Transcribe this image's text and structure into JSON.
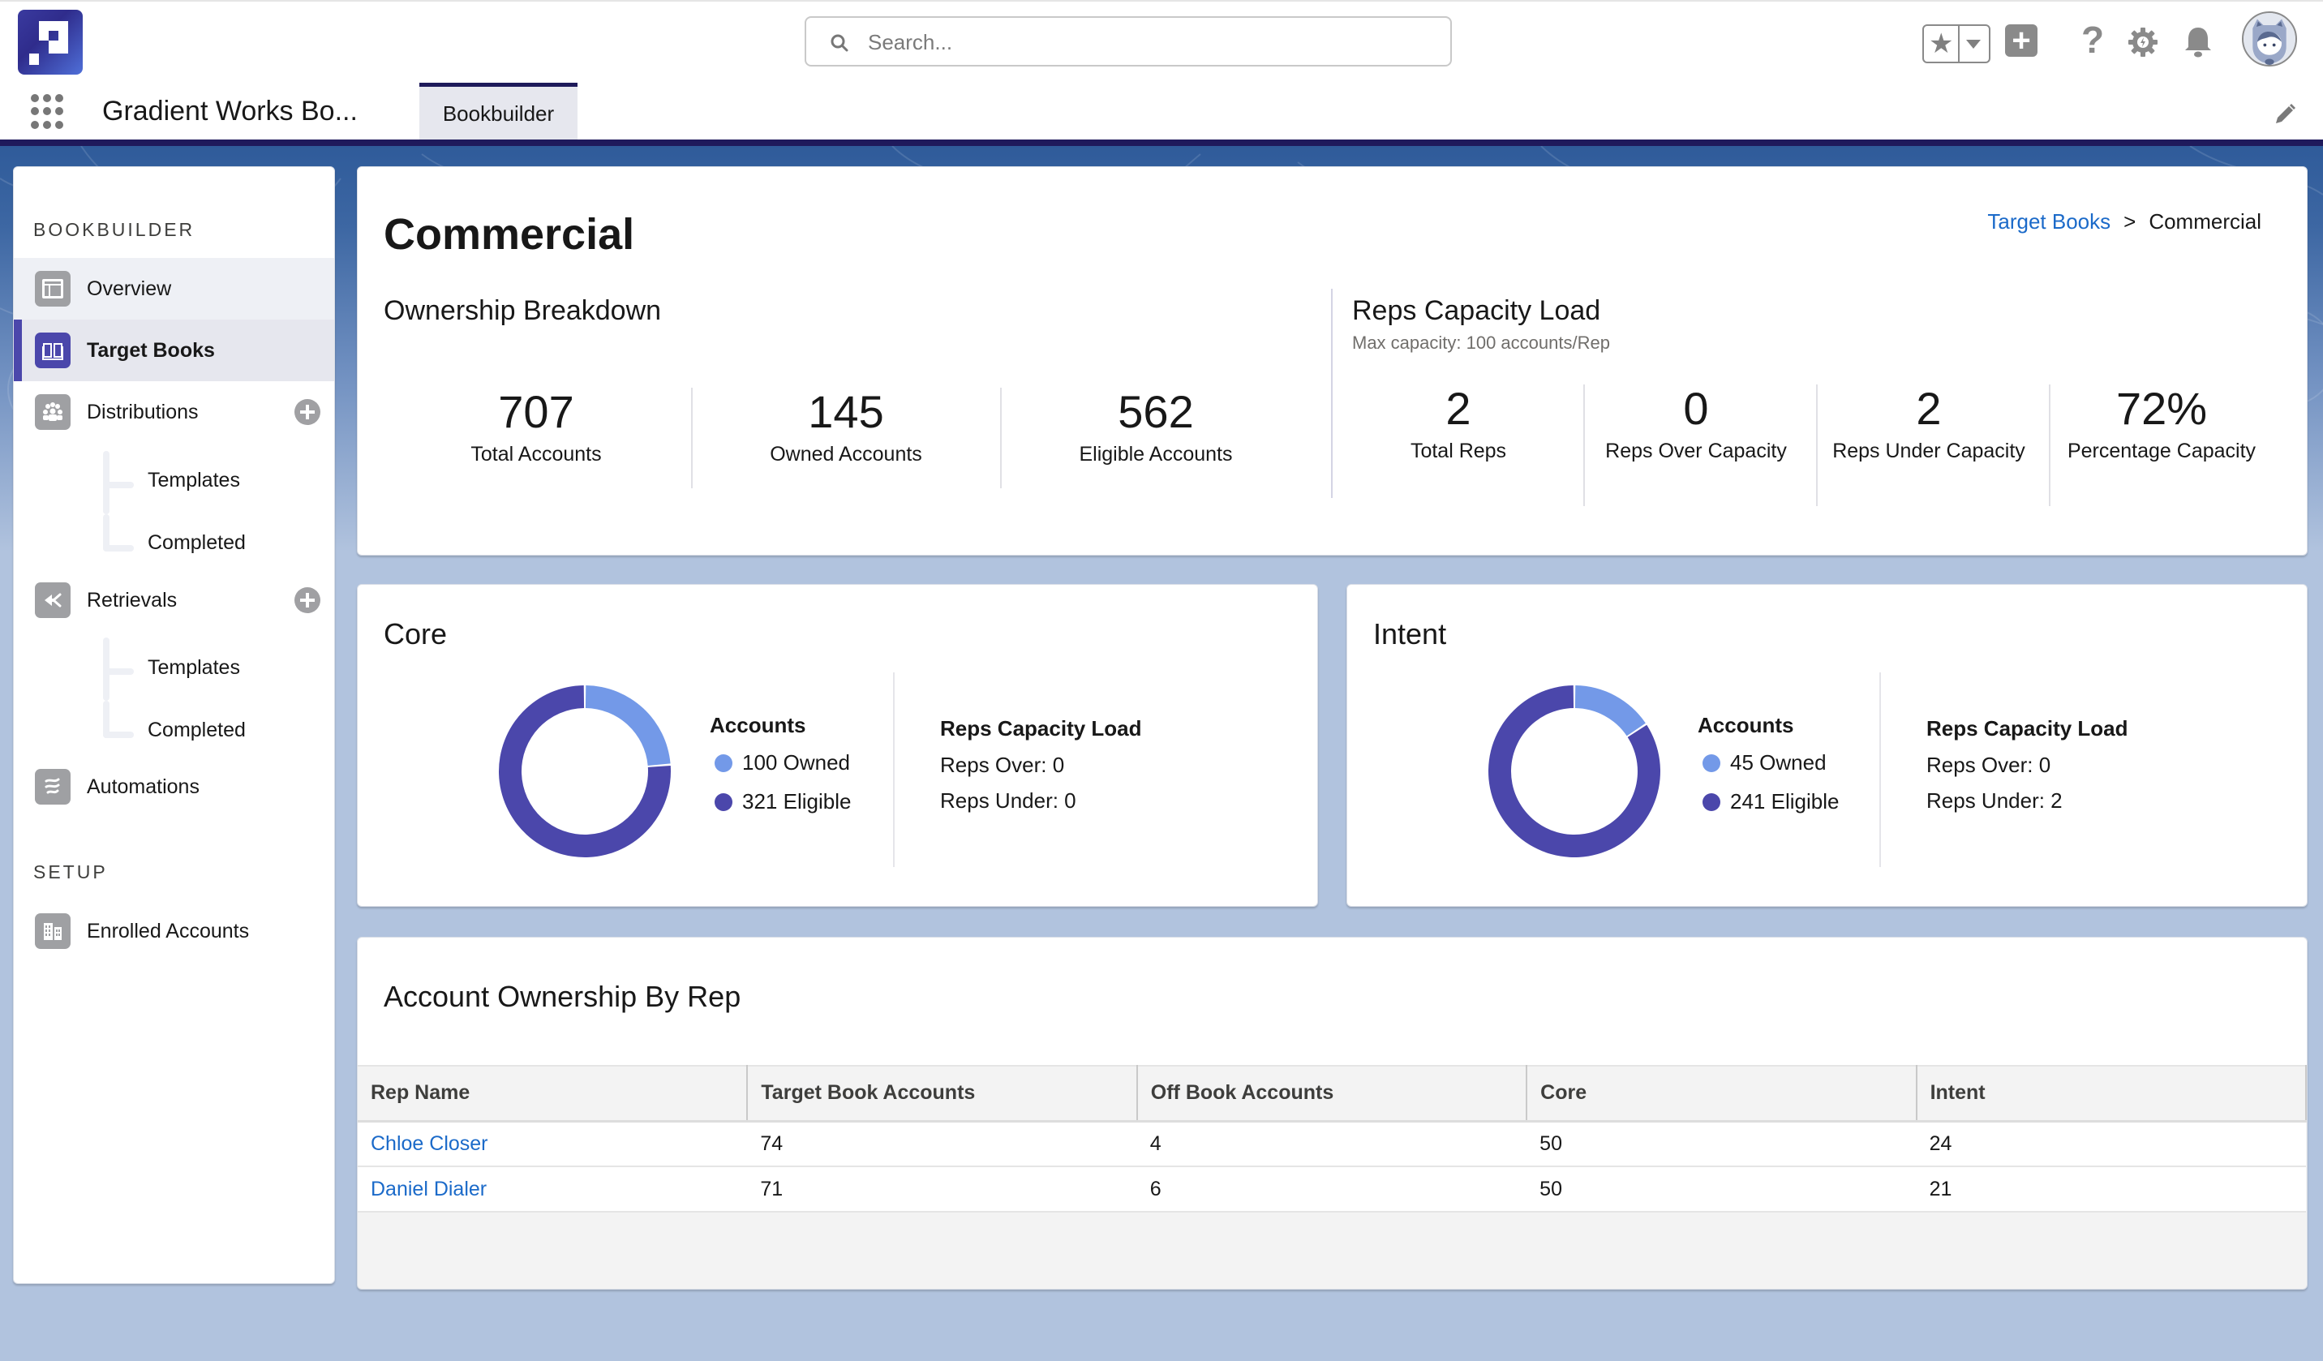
{
  "header": {
    "search": {
      "placeholder": "Search..."
    },
    "app_name": "Gradient Works Bo...",
    "tabs": [
      {
        "label": "Bookbuilder",
        "active": true
      }
    ],
    "icons": [
      "favorites-star-icon",
      "favorites-dropdown-icon",
      "global-add-icon",
      "help-icon",
      "setup-gear-icon",
      "notifications-bell-icon",
      "user-avatar",
      "edit-pencil-icon",
      "app-launcher-icon"
    ]
  },
  "sidebar": {
    "section_bookbuilder": "BOOKBUILDER",
    "section_setup": "SETUP",
    "items": [
      {
        "label": "Overview",
        "icon": "overview-layout-icon",
        "state": "hover"
      },
      {
        "label": "Target Books",
        "icon": "book-icon",
        "state": "active"
      },
      {
        "label": "Distributions",
        "icon": "groups-icon",
        "has_add": true,
        "children": [
          {
            "label": "Templates"
          },
          {
            "label": "Completed"
          }
        ]
      },
      {
        "label": "Retrievals",
        "icon": "retrieve-arrow-icon",
        "has_add": true,
        "children": [
          {
            "label": "Templates"
          },
          {
            "label": "Completed"
          }
        ]
      },
      {
        "label": "Automations",
        "icon": "automation-flow-icon"
      },
      {
        "label": "Enrolled Accounts",
        "icon": "buildings-icon"
      }
    ]
  },
  "page": {
    "title": "Commercial",
    "breadcrumb": {
      "parent": "Target Books",
      "separator": ">",
      "current": "Commercial"
    }
  },
  "ownership": {
    "title": "Ownership Breakdown",
    "stats": [
      {
        "value": "707",
        "label": "Total Accounts"
      },
      {
        "value": "145",
        "label": "Owned Accounts"
      },
      {
        "value": "562",
        "label": "Eligible Accounts"
      }
    ]
  },
  "capacity": {
    "title": "Reps Capacity Load",
    "subtitle": "Max capacity: 100 accounts/Rep",
    "stats": [
      {
        "value": "2",
        "label": "Total Reps"
      },
      {
        "value": "0",
        "label": "Reps Over Capacity"
      },
      {
        "value": "2",
        "label": "Reps Under Capacity"
      },
      {
        "value": "72%",
        "label": "Percentage Capacity"
      }
    ]
  },
  "colors": {
    "owned": "#7399e8",
    "eligible": "#4b47ab",
    "link": "#1b6ac9",
    "brand_navy": "#1f1a5c"
  },
  "segments": [
    {
      "title": "Core",
      "accounts_title": "Accounts",
      "owned_label": "100 Owned",
      "eligible_label": "321 Eligible",
      "owned": 100,
      "eligible": 321,
      "capacity_title": "Reps Capacity Load",
      "reps_over": "Reps Over: 0",
      "reps_under": "Reps Under: 0"
    },
    {
      "title": "Intent",
      "accounts_title": "Accounts",
      "owned_label": "45 Owned",
      "eligible_label": "241 Eligible",
      "owned": 45,
      "eligible": 241,
      "capacity_title": "Reps Capacity Load",
      "reps_over": "Reps Over: 0",
      "reps_under": "Reps Under: 2"
    }
  ],
  "table": {
    "title": "Account Ownership By Rep",
    "columns": [
      "Rep Name",
      "Target Book Accounts",
      "Off Book Accounts",
      "Core",
      "Intent"
    ],
    "rows": [
      [
        "Chloe Closer",
        "74",
        "4",
        "50",
        "24"
      ],
      [
        "Daniel Dialer",
        "71",
        "6",
        "50",
        "21"
      ]
    ]
  }
}
